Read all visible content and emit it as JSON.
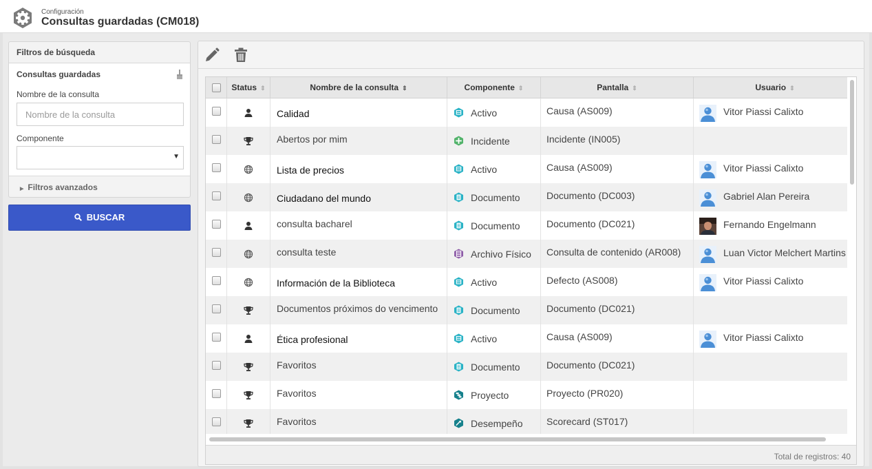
{
  "header": {
    "subtitle": "Configuración",
    "title": "Consultas guardadas (CM018)",
    "icon": "gear-hexagon-icon"
  },
  "filters": {
    "panel_title": "Filtros de búsqueda",
    "section_title": "Consultas guardadas",
    "name_label": "Nombre de la consulta",
    "name_placeholder": "Nombre de la consulta",
    "name_value": "",
    "component_label": "Componente",
    "component_selected": "",
    "advanced_label": "Filtros avanzados",
    "search_button": "BUSCAR"
  },
  "toolbar": {
    "edit_icon": "pencil-icon",
    "delete_icon": "trash-icon"
  },
  "table": {
    "columns": [
      {
        "label": ""
      },
      {
        "label": "Status"
      },
      {
        "label": "Nombre de la consulta"
      },
      {
        "label": "Componente"
      },
      {
        "label": "Pantalla"
      },
      {
        "label": "Usuario"
      }
    ],
    "rows": [
      {
        "status": "user",
        "name": "Calidad",
        "name_dark": true,
        "component_icon": "activo",
        "component": "Activo",
        "screen": "Causa (AS009)",
        "avatar": "default",
        "user": "Vitor Piassi Calixto"
      },
      {
        "status": "trophy",
        "name": "Abertos por mim",
        "name_dark": false,
        "component_icon": "incidente",
        "component": "Incidente",
        "screen": "Incidente (IN005)",
        "avatar": "",
        "user": ""
      },
      {
        "status": "globe",
        "name": "Lista de precios",
        "name_dark": true,
        "component_icon": "activo",
        "component": "Activo",
        "screen": "Causa (AS009)",
        "avatar": "default",
        "user": "Vitor Piassi Calixto"
      },
      {
        "status": "globe",
        "name": "Ciudadano del mundo",
        "name_dark": true,
        "component_icon": "documento",
        "component": "Documento",
        "screen": "Documento (DC003)",
        "avatar": "default",
        "user": "Gabriel Alan Pereira"
      },
      {
        "status": "user",
        "name": "consulta bacharel",
        "name_dark": false,
        "component_icon": "documento",
        "component": "Documento",
        "screen": "Documento (DC021)",
        "avatar": "photo",
        "user": "Fernando Engelmann"
      },
      {
        "status": "globe",
        "name": "consulta teste",
        "name_dark": false,
        "component_icon": "archivo",
        "component": "Archivo Físico",
        "screen": "Consulta de contenido (AR008)",
        "avatar": "default",
        "user": "Luan Victor Melchert Martins"
      },
      {
        "status": "globe",
        "name": "Información de la Biblioteca",
        "name_dark": true,
        "component_icon": "activo",
        "component": "Activo",
        "screen": "Defecto (AS008)",
        "avatar": "default",
        "user": "Vitor Piassi Calixto"
      },
      {
        "status": "trophy",
        "name": "Documentos próximos do vencimento",
        "name_dark": false,
        "component_icon": "documento",
        "component": "Documento",
        "screen": "Documento (DC021)",
        "avatar": "",
        "user": ""
      },
      {
        "status": "user",
        "name": "Ética profesional",
        "name_dark": true,
        "component_icon": "activo",
        "component": "Activo",
        "screen": "Causa (AS009)",
        "avatar": "default",
        "user": "Vitor Piassi Calixto"
      },
      {
        "status": "trophy",
        "name": "Favoritos",
        "name_dark": false,
        "component_icon": "documento",
        "component": "Documento",
        "screen": "Documento (DC021)",
        "avatar": "",
        "user": ""
      },
      {
        "status": "trophy",
        "name": "Favoritos",
        "name_dark": false,
        "component_icon": "proyecto",
        "component": "Proyecto",
        "screen": "Proyecto (PR020)",
        "avatar": "",
        "user": ""
      },
      {
        "status": "trophy",
        "name": "Favoritos",
        "name_dark": false,
        "component_icon": "desempeno",
        "component": "Desempeño",
        "screen": "Scorecard (ST017)",
        "avatar": "",
        "user": ""
      }
    ]
  },
  "footer": {
    "total": "Total de registros: 40"
  },
  "colors": {
    "accent": "#3a59c9",
    "activo": "#2ab3c6",
    "incidente": "#52b36b",
    "archivo": "#8e5da8",
    "proyecto": "#16818c"
  }
}
